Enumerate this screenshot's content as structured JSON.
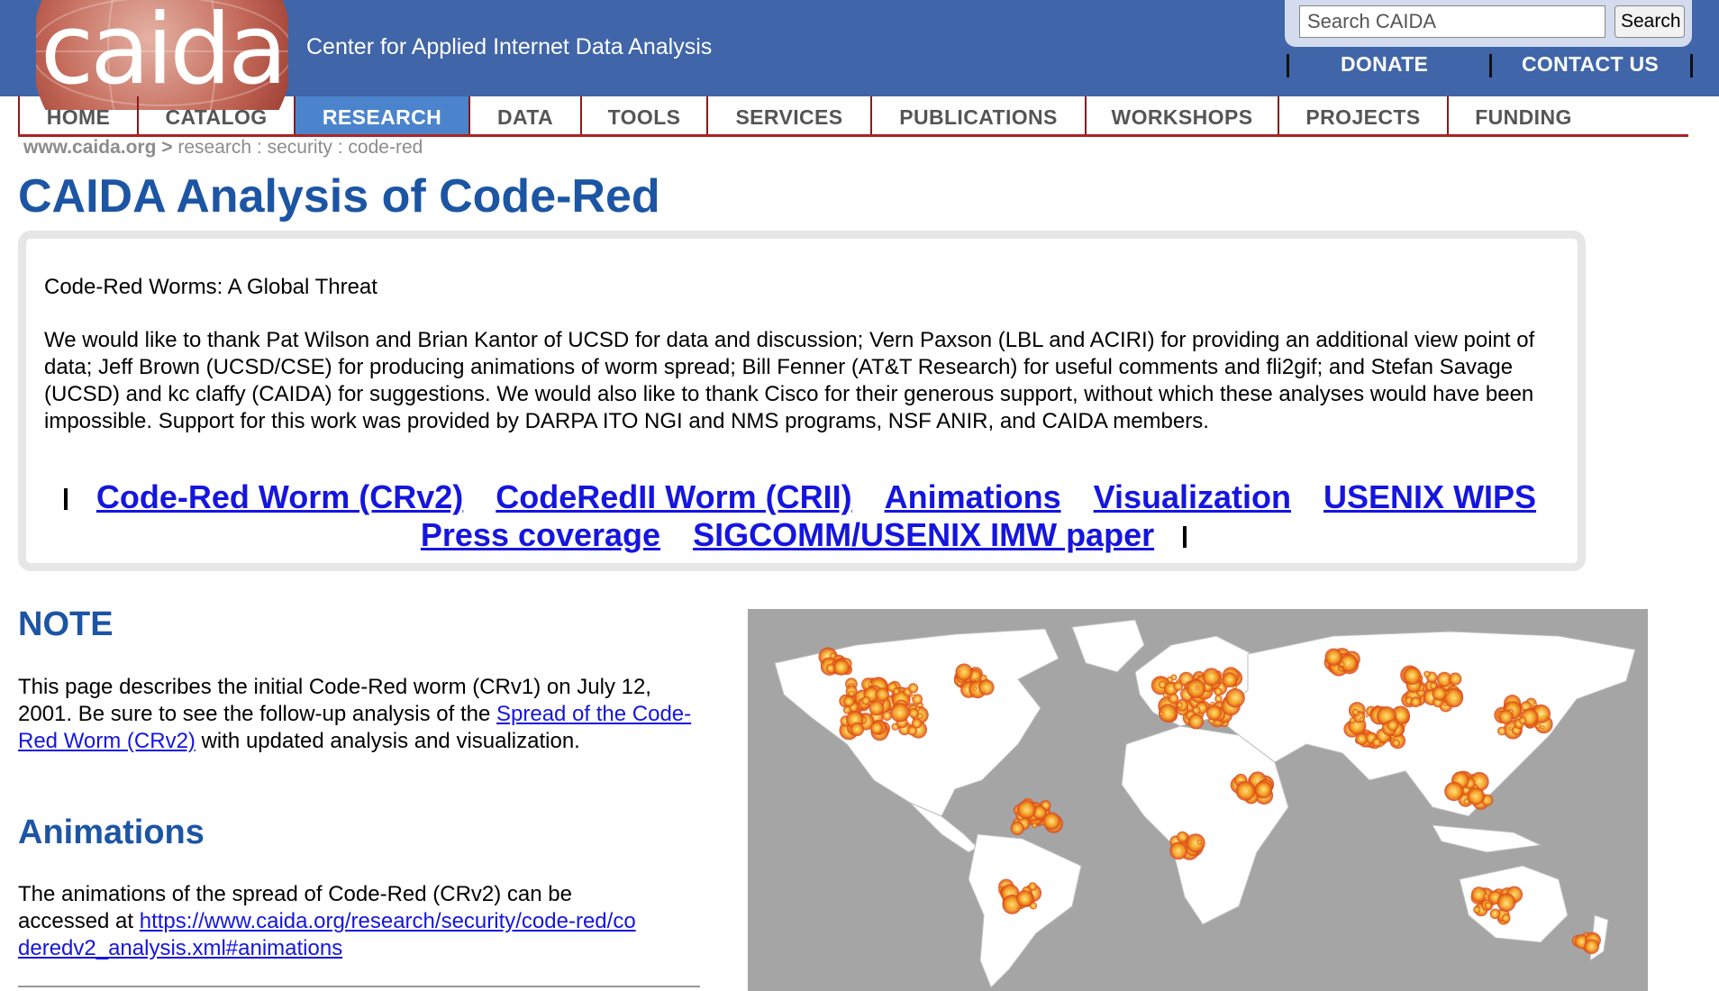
{
  "header": {
    "logo_text": "caida",
    "tagline": "Center for Applied Internet Data Analysis",
    "search_placeholder": "Search CAIDA",
    "search_button": "Search",
    "donate": "DONATE",
    "contact": "CONTACT US"
  },
  "nav": {
    "items": [
      "HOME",
      "CATALOG",
      "RESEARCH",
      "DATA",
      "TOOLS",
      "SERVICES",
      "PUBLICATIONS",
      "WORKSHOPS",
      "PROJECTS",
      "FUNDING"
    ],
    "active": "RESEARCH"
  },
  "breadcrumb": {
    "site": "www.caida.org",
    "sep": ">",
    "path": "research : security : code-red"
  },
  "page": {
    "title": "CAIDA Analysis of Code-Red"
  },
  "intro": {
    "heading": "Code-Red Worms: A Global Threat",
    "text": "We would like to thank Pat Wilson and Brian Kantor of UCSD for data and discussion; Vern Paxson (LBL and ACIRI) for providing an additional view point of data; Jeff Brown (UCSD/CSE) for producing animations of worm spread; Bill Fenner (AT&T Research) for useful comments and fli2gif; and Stefan Savage (UCSD) and kc claffy (CAIDA) for suggestions. We would also like to thank Cisco for their generous support, without which these analyses would have been impossible. Support for this work was provided by DARPA ITO NGI and NMS programs, NSF ANIR, and CAIDA members.",
    "links": [
      "Code-Red Worm (CRv2)",
      "CodeRedII Worm (CRII)",
      "Animations",
      "Visualization",
      "USENIX WIPS",
      "Press coverage",
      "SIGCOMM/USENIX IMW paper"
    ]
  },
  "note": {
    "heading": "NOTE",
    "text_before": "This page describes the initial Code-Red worm (CRv1) on July 12, 2001. Be sure to see the follow-up analysis of the ",
    "link": "Spread of the Code-Red Worm (CRv2)",
    "text_after": " with updated analysis and visualization."
  },
  "animations": {
    "heading": "Animations",
    "text": "The animations of the spread of Code-Red (CRv2) can be accessed at ",
    "link": "https://www.caida.org/research/security/code-red/coderedv2_analysis.xml#animations"
  },
  "colors": {
    "header_bg": "#4065a8",
    "nav_active": "#4b84cc",
    "title_blue": "#1c55a3",
    "link_blue": "#1515e0",
    "nav_rule": "#b02222",
    "map_bg": "#a5a5a5"
  }
}
